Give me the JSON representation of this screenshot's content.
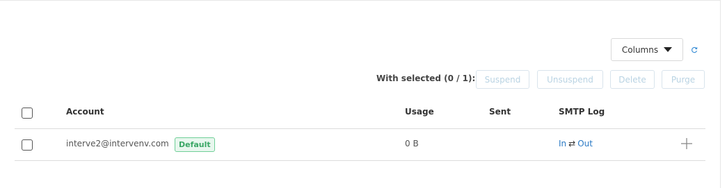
{
  "toolbar": {
    "columns_label": "Columns",
    "refresh_icon": "refresh-icon"
  },
  "bulk": {
    "with_selected": "With selected (0 / 1):",
    "suspend": "Suspend",
    "unsuspend": "Unsuspend",
    "delete": "Delete",
    "purge": "Purge"
  },
  "table": {
    "headers": {
      "account": "Account",
      "usage": "Usage",
      "sent": "Sent",
      "smtp_log": "SMTP Log"
    },
    "rows": [
      {
        "account": "interve2@intervenv.com",
        "badge": "Default",
        "usage": "0 B",
        "sent": "",
        "smtp_in": "In",
        "smtp_arrows": "⇄",
        "smtp_out": "Out"
      }
    ]
  },
  "colors": {
    "badge_border": "#6fcf97",
    "badge_text": "#3aa765",
    "link": "#2a79c4",
    "disabled_button_text": "#b9d3e3"
  }
}
